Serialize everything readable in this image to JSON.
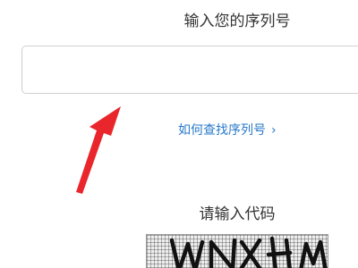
{
  "serial": {
    "title": "输入您的序列号",
    "input_value": "",
    "find_link": "如何查找序列号",
    "find_link_chevron": "›"
  },
  "captcha": {
    "title": "请输入代码",
    "image_text": "WNXHM"
  },
  "annotation": {
    "arrow_color": "#e8262b"
  },
  "colors": {
    "link": "#2779c9",
    "text": "#333333",
    "border": "#cfcfcf"
  }
}
